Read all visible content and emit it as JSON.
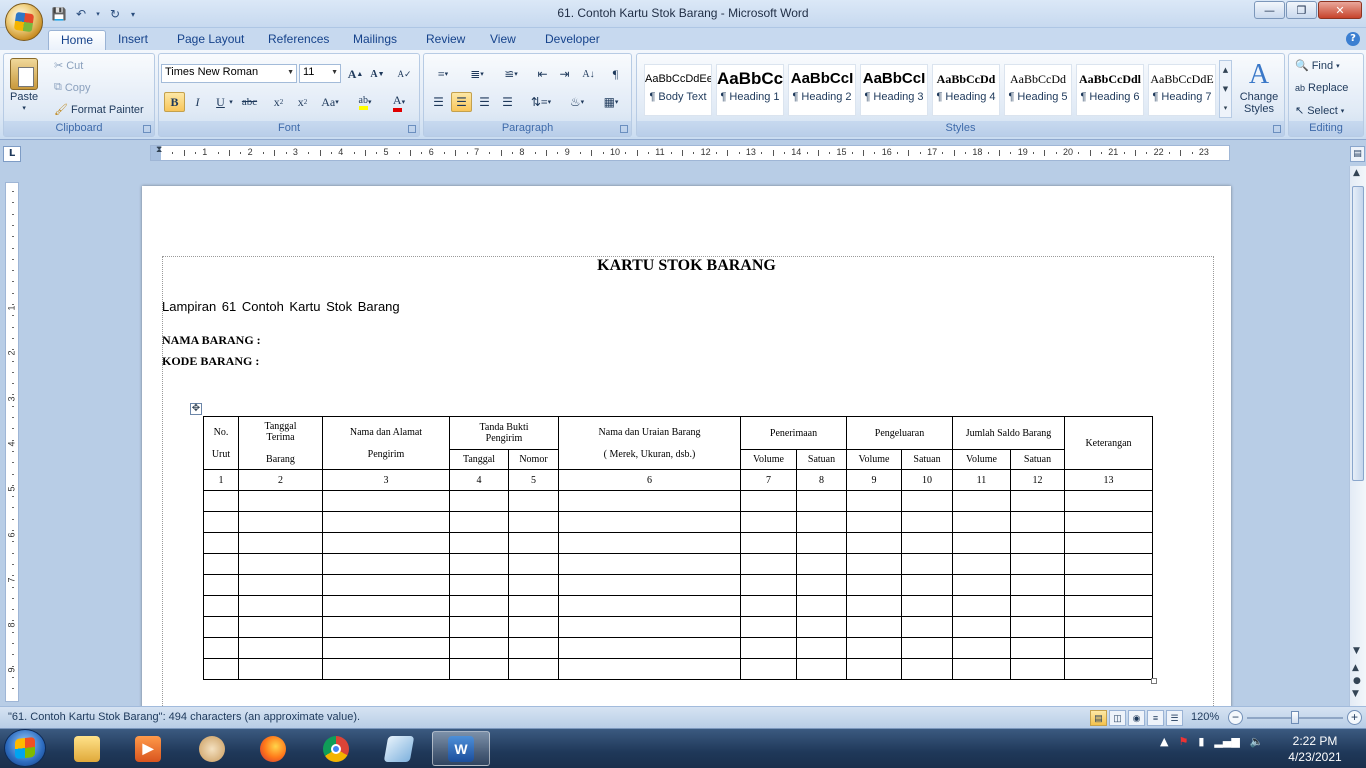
{
  "window": {
    "title": "61. Contoh Kartu Stok Barang - Microsoft Word"
  },
  "tabs": [
    "Home",
    "Insert",
    "Page Layout",
    "References",
    "Mailings",
    "Review",
    "View",
    "Developer"
  ],
  "clipboard": {
    "paste": "Paste",
    "cut": "Cut",
    "copy": "Copy",
    "format_painter": "Format Painter",
    "label": "Clipboard"
  },
  "font": {
    "name": "Times New Roman",
    "size": "11",
    "label": "Font"
  },
  "paragraph": {
    "label": "Paragraph"
  },
  "styles": {
    "label": "Styles",
    "items": [
      {
        "sample": "AaBbCcDdEe",
        "name": "¶ Body Text"
      },
      {
        "sample": "AaBbCc",
        "name": "¶ Heading 1"
      },
      {
        "sample": "AaBbCcI",
        "name": "¶ Heading 2"
      },
      {
        "sample": "AaBbCcI",
        "name": "¶ Heading 3"
      },
      {
        "sample": "AaBbCcDd",
        "name": "¶ Heading 4"
      },
      {
        "sample": "AaBbCcDd",
        "name": "¶ Heading 5"
      },
      {
        "sample": "AaBbCcDdl",
        "name": "¶ Heading 6"
      },
      {
        "sample": "AaBbCcDdE",
        "name": "¶ Heading 7"
      }
    ],
    "change_styles": "Change Styles"
  },
  "editing": {
    "find": "Find",
    "replace": "Replace",
    "select": "Select",
    "label": "Editing"
  },
  "ruler_numbers": [
    "1",
    "2",
    "3",
    "4",
    "5",
    "6",
    "7",
    "8",
    "9",
    "10",
    "11",
    "12",
    "13",
    "14",
    "15",
    "16",
    "17",
    "18",
    "19",
    "20",
    "21",
    "22",
    "23"
  ],
  "vruler_numbers": [
    "1",
    "2",
    "3",
    "4",
    "5",
    "6",
    "7",
    "8",
    "9"
  ],
  "document": {
    "title": "KARTU STOK BARANG",
    "subtitle": "Lampiran 61 Contoh Kartu Stok Barang",
    "nama_barang": "NAMA BARANG :",
    "kode_barang": "KODE BARANG :",
    "table": {
      "no": "No.",
      "urut": "Urut",
      "tanggal_terima": "Tanggal Terima",
      "barang": "Barang",
      "nama_alamat": "Nama dan Alamat",
      "pengirim": "Pengirim",
      "tanda_bukti": "Tanda Bukti Pengirim",
      "tanggal": "Tanggal",
      "nomor": "Nomor",
      "nama_uraian": "Nama dan Uraian Barang",
      "merek": "( Merek, Ukuran, dsb.)",
      "penerimaan": "Penerimaan",
      "pengeluaran": "Pengeluaran",
      "jumlah_saldo": "Jumlah Saldo Barang",
      "volume": "Volume",
      "satuan": "Satuan",
      "keterangan": "Keterangan",
      "col_numbers": [
        "1",
        "2",
        "3",
        "4",
        "5",
        "6",
        "7",
        "8",
        "9",
        "10",
        "11",
        "12",
        "13"
      ],
      "empty_rows": 9
    }
  },
  "status": {
    "text": "\"61. Contoh Kartu Stok Barang\": 494 characters (an approximate value).",
    "zoom": "120%"
  },
  "clock": {
    "time": "2:22 PM",
    "date": "4/23/2021"
  }
}
